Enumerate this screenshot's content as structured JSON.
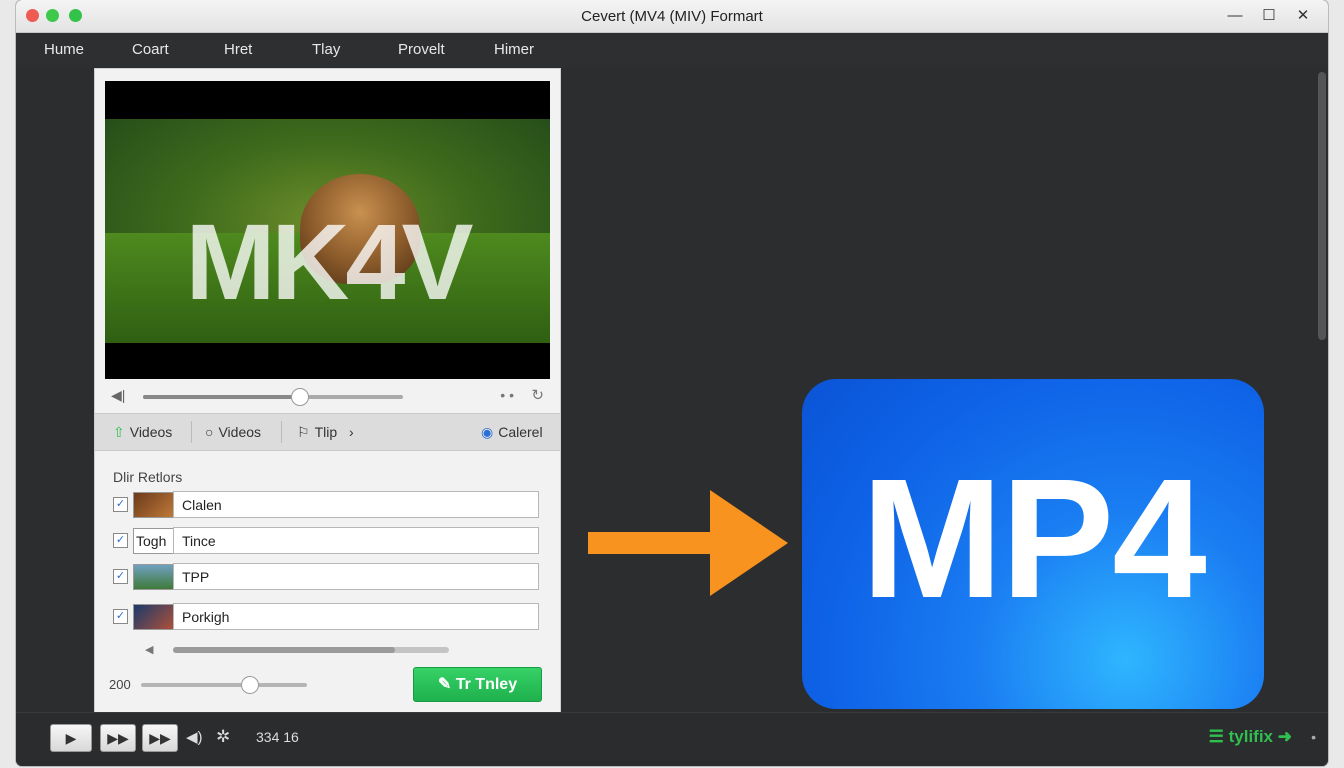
{
  "window": {
    "title": "Cevert (MV4 (MIV) Formart",
    "min_glyph": "—",
    "max_glyph": "☐",
    "close_glyph": "✕"
  },
  "menu": [
    "Hume",
    "Coart",
    "Hret",
    "Tlay",
    "Provelt",
    "Himer"
  ],
  "preview": {
    "overlay_text": "MK4V"
  },
  "player": {
    "volume_icon": "volume-icon",
    "dots": "• •",
    "refresh_glyph": "↻",
    "seek_progress": 0.6
  },
  "tabs": [
    {
      "icon": "⇧",
      "label": "Videos",
      "icon_name": "upload-icon"
    },
    {
      "icon": "○",
      "label": "Videos",
      "icon_name": "circle-icon"
    },
    {
      "icon": "⚐",
      "label": "Tlip",
      "icon_name": "flag-icon",
      "suffix": "›"
    },
    {
      "icon": "◉",
      "label": "Calerel",
      "icon_name": "target-icon"
    }
  ],
  "files": {
    "section_label": "Dlir Retlors",
    "items": [
      {
        "name": "Clalen",
        "checked": true,
        "thumb_text": ""
      },
      {
        "name": "Tince",
        "checked": true,
        "thumb_text": "Togh"
      },
      {
        "name": "TPP",
        "checked": true,
        "thumb_text": ""
      },
      {
        "name": "Porkigh",
        "checked": true,
        "thumb_text": ""
      }
    ],
    "check_glyph": "✓"
  },
  "quality": {
    "label": "200",
    "level": 0.65
  },
  "convert_button": {
    "label": "✎ Tr Tnley"
  },
  "target_format": {
    "label": "MP4"
  },
  "colors": {
    "accent_green": "#22b14c",
    "arrow_orange": "#f7931e",
    "tile_blue": "#1a7df2"
  },
  "bottom": {
    "play_glyph": "▶",
    "next_glyph": "▶▶",
    "skip_glyph": "▶▶",
    "size_text": "334 16",
    "brand": "tylifix",
    "brand_prefix": "☰",
    "brand_suffix": "➜"
  }
}
